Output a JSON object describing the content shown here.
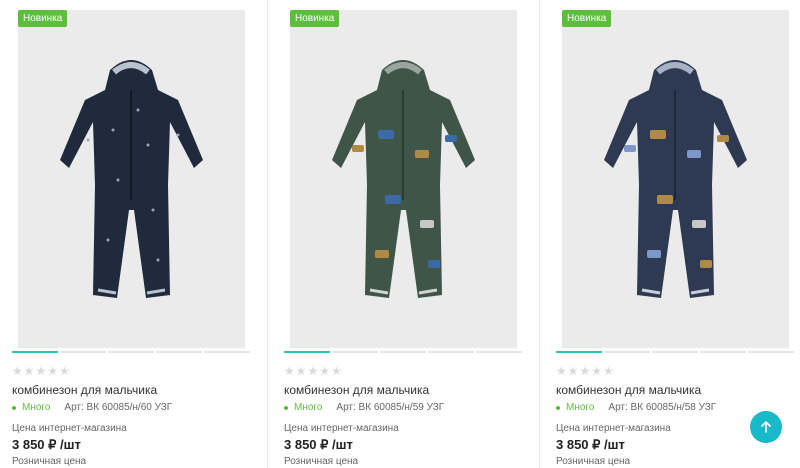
{
  "products": [
    {
      "badge": "Новинка",
      "stars": "★★★★★",
      "title": "комбинезон для мальчика",
      "stock": "Много",
      "article": "Арт: ВК 60085/н/60 УЗГ",
      "price_label": "Цена интернет-магазина",
      "price": "3 850 ₽ /шт",
      "retail_label": "Розничная цена",
      "color": "#1f2a3d"
    },
    {
      "badge": "Новинка",
      "stars": "★★★★★",
      "title": "комбинезон для мальчика",
      "stock": "Много",
      "article": "Арт: ВК 60085/н/59 УЗГ",
      "price_label": "Цена интернет-магазина",
      "price": "3 850 ₽ /шт",
      "retail_label": "Розничная цена",
      "color": "#3f5548"
    },
    {
      "badge": "Новинка",
      "stars": "★★★★★",
      "title": "комбинезон для мальчика",
      "stock": "Много",
      "article": "Арт: ВК 60085/н/58 УЗГ",
      "price_label": "Цена интернет-магазина",
      "price": "3 850 ₽ /шт",
      "retail_label": "Розничная цена",
      "color": "#2e3a52"
    }
  ],
  "scroll_top_icon": "arrow-up-icon",
  "accent": "#29c3c9",
  "badge_color": "#5cbf3a"
}
